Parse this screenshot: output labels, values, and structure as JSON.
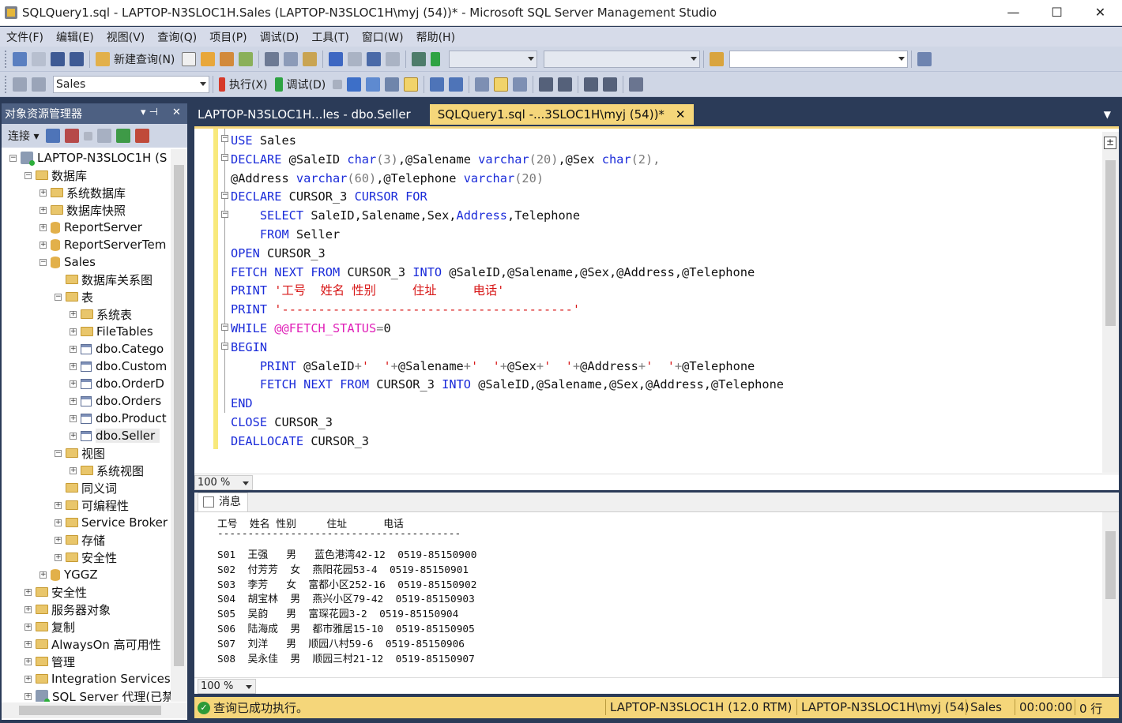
{
  "window": {
    "title": "SQLQuery1.sql - LAPTOP-N3SLOC1H.Sales (LAPTOP-N3SLOC1H\\myj (54))* - Microsoft SQL Server Management Studio",
    "minimize": "—",
    "maximize": "☐",
    "close": "✕"
  },
  "menu": [
    "文件(F)",
    "编辑(E)",
    "视图(V)",
    "查询(Q)",
    "项目(P)",
    "调试(D)",
    "工具(T)",
    "窗口(W)",
    "帮助(H)"
  ],
  "toolbar1": {
    "new_query": "新建查询(N)"
  },
  "toolbar2": {
    "database": "Sales",
    "execute": "执行(X)",
    "debug": "调试(D)"
  },
  "object_explorer": {
    "title": "对象资源管理器",
    "pin": "▾  ⊣",
    "close": "✕",
    "connect": "连接 ▾",
    "nodes": [
      {
        "label": "LAPTOP-N3SLOC1H (S"
      },
      {
        "label": "数据库"
      },
      {
        "label": "系统数据库"
      },
      {
        "label": "数据库快照"
      },
      {
        "label": "ReportServer"
      },
      {
        "label": "ReportServerTem"
      },
      {
        "label": "Sales"
      },
      {
        "label": "数据库关系图"
      },
      {
        "label": "表"
      },
      {
        "label": "系统表"
      },
      {
        "label": "FileTables"
      },
      {
        "label": "dbo.Catego"
      },
      {
        "label": "dbo.Custom"
      },
      {
        "label": "dbo.OrderD"
      },
      {
        "label": "dbo.Orders"
      },
      {
        "label": "dbo.Product"
      },
      {
        "label": "dbo.Seller"
      },
      {
        "label": "视图"
      },
      {
        "label": "系统视图"
      },
      {
        "label": "同义词"
      },
      {
        "label": "可编程性"
      },
      {
        "label": "Service Broker"
      },
      {
        "label": "存储"
      },
      {
        "label": "安全性"
      },
      {
        "label": "YGGZ"
      },
      {
        "label": "安全性"
      },
      {
        "label": "服务器对象"
      },
      {
        "label": "复制"
      },
      {
        "label": "AlwaysOn 高可用性"
      },
      {
        "label": "管理"
      },
      {
        "label": "Integration Services"
      },
      {
        "label": "SQL Server 代理(已禁"
      }
    ]
  },
  "tabs": [
    {
      "label": "LAPTOP-N3SLOC1H...les - dbo.Seller"
    },
    {
      "label": "SQLQuery1.sql -...3SLOC1H\\myj (54))*",
      "close": "✕"
    }
  ],
  "editor": {
    "zoom": "100 %",
    "lines": [
      [
        {
          "t": "USE",
          "c": "kw"
        },
        {
          "t": " Sales"
        }
      ],
      [
        {
          "t": "DECLARE",
          "c": "kw"
        },
        {
          "t": " @SaleID "
        },
        {
          "t": "char",
          "c": "kw"
        },
        {
          "t": "(3)",
          "c": "gray"
        },
        {
          "t": ",@Salename "
        },
        {
          "t": "varchar",
          "c": "kw"
        },
        {
          "t": "(20)",
          "c": "gray"
        },
        {
          "t": ",@Sex "
        },
        {
          "t": "char",
          "c": "kw"
        },
        {
          "t": "(2)",
          "c": "gray"
        },
        {
          "t": ",",
          "c": "gray"
        }
      ],
      [
        {
          "t": "@Address "
        },
        {
          "t": "varchar",
          "c": "kw"
        },
        {
          "t": "(60)",
          "c": "gray"
        },
        {
          "t": ",@Telephone "
        },
        {
          "t": "varchar",
          "c": "kw"
        },
        {
          "t": "(20)",
          "c": "gray"
        }
      ],
      [
        {
          "t": "DECLARE",
          "c": "kw"
        },
        {
          "t": " CURSOR_3 "
        },
        {
          "t": "CURSOR",
          "c": "kw"
        },
        {
          "t": " "
        },
        {
          "t": "FOR",
          "c": "kw"
        }
      ],
      [
        {
          "t": "    "
        },
        {
          "t": "SELECT",
          "c": "kw"
        },
        {
          "t": " SaleID,Salename,Sex,"
        },
        {
          "t": "Address",
          "c": "kw"
        },
        {
          "t": ",Telephone"
        }
      ],
      [
        {
          "t": "    "
        },
        {
          "t": "FROM",
          "c": "kw"
        },
        {
          "t": " Seller"
        }
      ],
      [
        {
          "t": "OPEN",
          "c": "kw"
        },
        {
          "t": " CURSOR_3"
        }
      ],
      [
        {
          "t": "FETCH",
          "c": "kw"
        },
        {
          "t": " "
        },
        {
          "t": "NEXT",
          "c": "kw"
        },
        {
          "t": " "
        },
        {
          "t": "FROM",
          "c": "kw"
        },
        {
          "t": " CURSOR_3 "
        },
        {
          "t": "INTO",
          "c": "kw"
        },
        {
          "t": " @SaleID,@Salename,@Sex,@Address,@Telephone"
        }
      ],
      [
        {
          "t": "PRINT",
          "c": "kw"
        },
        {
          "t": " "
        },
        {
          "t": "'工号  姓名 性别     住址     电话'",
          "c": "str"
        }
      ],
      [
        {
          "t": "PRINT",
          "c": "kw"
        },
        {
          "t": " "
        },
        {
          "t": "'----------------------------------------'",
          "c": "str"
        }
      ],
      [
        {
          "t": "WHILE",
          "c": "kw"
        },
        {
          "t": " "
        },
        {
          "t": "@@FETCH_STATUS",
          "c": "fn"
        },
        {
          "t": "=",
          "c": "gray"
        },
        {
          "t": "0"
        }
      ],
      [
        {
          "t": "BEGIN",
          "c": "kw"
        }
      ],
      [
        {
          "t": "    "
        },
        {
          "t": "PRINT",
          "c": "kw"
        },
        {
          "t": " @SaleID"
        },
        {
          "t": "+",
          "c": "gray"
        },
        {
          "t": "'  '",
          "c": "str"
        },
        {
          "t": "+",
          "c": "gray"
        },
        {
          "t": "@Salename"
        },
        {
          "t": "+",
          "c": "gray"
        },
        {
          "t": "'  '",
          "c": "str"
        },
        {
          "t": "+",
          "c": "gray"
        },
        {
          "t": "@Sex"
        },
        {
          "t": "+",
          "c": "gray"
        },
        {
          "t": "'  '",
          "c": "str"
        },
        {
          "t": "+",
          "c": "gray"
        },
        {
          "t": "@Address"
        },
        {
          "t": "+",
          "c": "gray"
        },
        {
          "t": "'  '",
          "c": "str"
        },
        {
          "t": "+",
          "c": "gray"
        },
        {
          "t": "@Telephone"
        }
      ],
      [
        {
          "t": "    "
        },
        {
          "t": "FETCH",
          "c": "kw"
        },
        {
          "t": " "
        },
        {
          "t": "NEXT",
          "c": "kw"
        },
        {
          "t": " "
        },
        {
          "t": "FROM",
          "c": "kw"
        },
        {
          "t": " CURSOR_3 "
        },
        {
          "t": "INTO",
          "c": "kw"
        },
        {
          "t": " @SaleID,@Salename,@Sex,@Address,@Telephone"
        }
      ],
      [
        {
          "t": "END",
          "c": "kw"
        }
      ],
      [
        {
          "t": "CLOSE",
          "c": "kw"
        },
        {
          "t": " CURSOR_3"
        }
      ],
      [
        {
          "t": "DEALLOCATE",
          "c": "kw"
        },
        {
          "t": " CURSOR_3"
        }
      ]
    ]
  },
  "messages": {
    "tab_label": "消息",
    "zoom": "100 %",
    "header": "工号  姓名 性别     住址      电话",
    "divider": "----------------------------------------",
    "rows": [
      "S01  王强   男   蓝色港湾42-12  0519-85150900",
      "S02  付芳芳  女  燕阳花园53-4  0519-85150901",
      "S03  李芳   女  富都小区252-16  0519-85150902",
      "S04  胡宝林  男  燕兴小区79-42  0519-85150903",
      "S05  吴韵   男  富琛花园3-2  0519-85150904",
      "S06  陆海成  男  都市雅居15-10  0519-85150905",
      "S07  刘洋   男  顺园八村59-6  0519-85150906",
      "S08  吴永佳  男  顺园三村21-12  0519-85150907"
    ]
  },
  "status": {
    "message": "查询已成功执行。",
    "server": "LAPTOP-N3SLOC1H (12.0 RTM)",
    "user": "LAPTOP-N3SLOC1H\\myj (54)",
    "database": "Sales",
    "elapsed": "00:00:00",
    "rows": "0 行"
  }
}
